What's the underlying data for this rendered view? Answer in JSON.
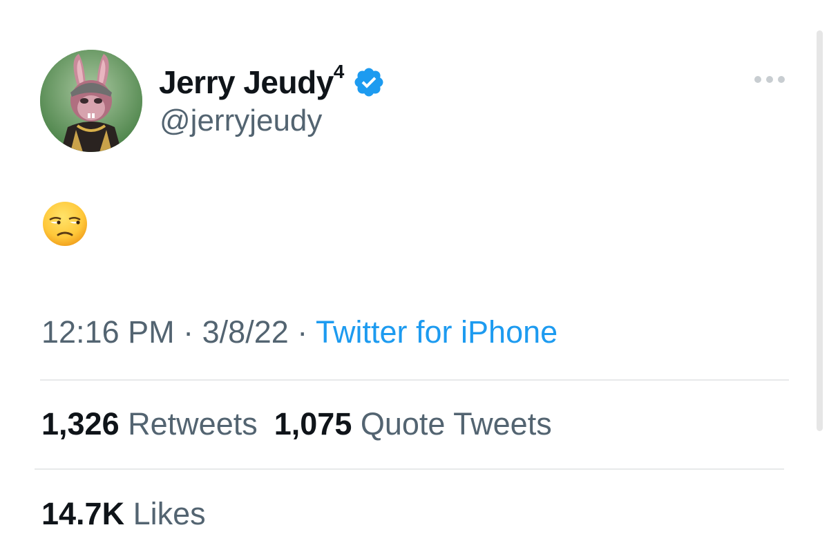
{
  "author": {
    "display_name": "Jerry Jeudy",
    "name_suffix": "4",
    "handle": "@jerryjeudy",
    "verified": true,
    "avatar_icon": "bape-rabbit-avatar",
    "avatar_background": "#5a9356"
  },
  "tweet": {
    "body_icon": "unamused-face-emoji"
  },
  "meta": {
    "time": "12:16 PM",
    "separator": "·",
    "date": "3/8/22",
    "source": "Twitter for iPhone"
  },
  "stats": {
    "retweets_count": "1,326",
    "retweets_label": "Retweets",
    "quotes_count": "1,075",
    "quotes_label": "Quote Tweets",
    "likes_count": "14.7K",
    "likes_label": "Likes"
  },
  "colors": {
    "text_primary": "#0f1419",
    "text_secondary": "#536471",
    "accent": "#1d9bf0",
    "divider": "#e7e9ea"
  },
  "icons": {
    "verified": "verified-badge-icon",
    "more": "more-horizontal-icon"
  }
}
